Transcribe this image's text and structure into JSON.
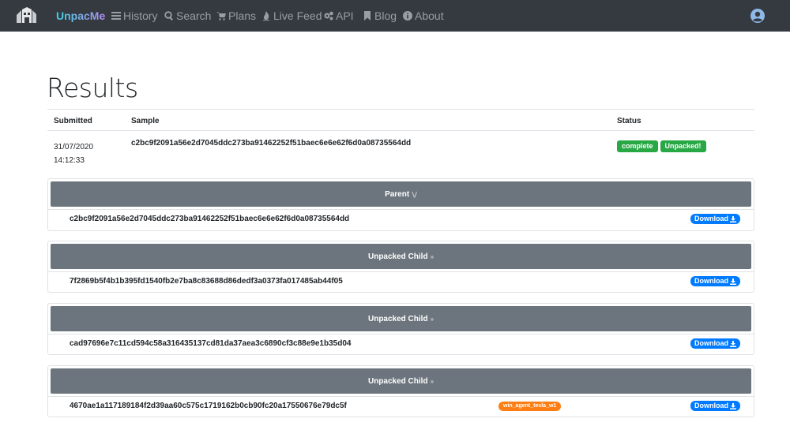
{
  "nav": {
    "brand": "UnpacMe",
    "items": [
      {
        "label": "History",
        "icon": "list-icon"
      },
      {
        "label": "Search",
        "icon": "search-icon"
      },
      {
        "label": "Plans",
        "icon": "cart-icon"
      },
      {
        "label": "Live Feed",
        "icon": "fire-icon"
      },
      {
        "label": "API",
        "icon": "gears-icon"
      },
      {
        "label": "Blog",
        "icon": "bookmark-icon"
      },
      {
        "label": "About",
        "icon": "info-icon"
      }
    ]
  },
  "page": {
    "title": "Results"
  },
  "results": {
    "headers": {
      "submitted": "Submitted",
      "sample": "Sample",
      "status": "Status"
    },
    "row": {
      "date": "31/07/2020",
      "time": "14:12:33",
      "sample": "c2bc9f2091a56e2d7045ddc273ba91462252f51baec6e6e62f6d0a08735564dd",
      "status": "complete",
      "unpacked": "Unpacked!"
    }
  },
  "cards": [
    {
      "title": "Parent",
      "hash": "c2bc9f2091a56e2d7045ddc273ba91462252f51baec6e6e62f6d0a08735564dd",
      "download": "Download",
      "yara": ""
    },
    {
      "title": "Unpacked Child",
      "hash": "7f2869b5f4b1b395fd1540fb2e7ba8c83688d86dedf3a0373fa017485ab44f05",
      "download": "Download",
      "yara": ""
    },
    {
      "title": "Unpacked Child",
      "hash": "cad97696e7c11cd594c58a316435137cd81da37aea3c6890cf3c88e9e1b35d04",
      "download": "Download",
      "yara": ""
    },
    {
      "title": "Unpacked Child",
      "hash": "4670ae1a117189184f2d39aa60c575c1719162b0cb90fc20a17550676e79dc5f",
      "download": "Download",
      "yara": "win_agent_tesla_w1"
    }
  ],
  "colors": {
    "navbar": "#343a40",
    "success": "#28a745",
    "primary": "#007bff",
    "card_header": "#6c757d",
    "yara": "#fd7e14"
  }
}
